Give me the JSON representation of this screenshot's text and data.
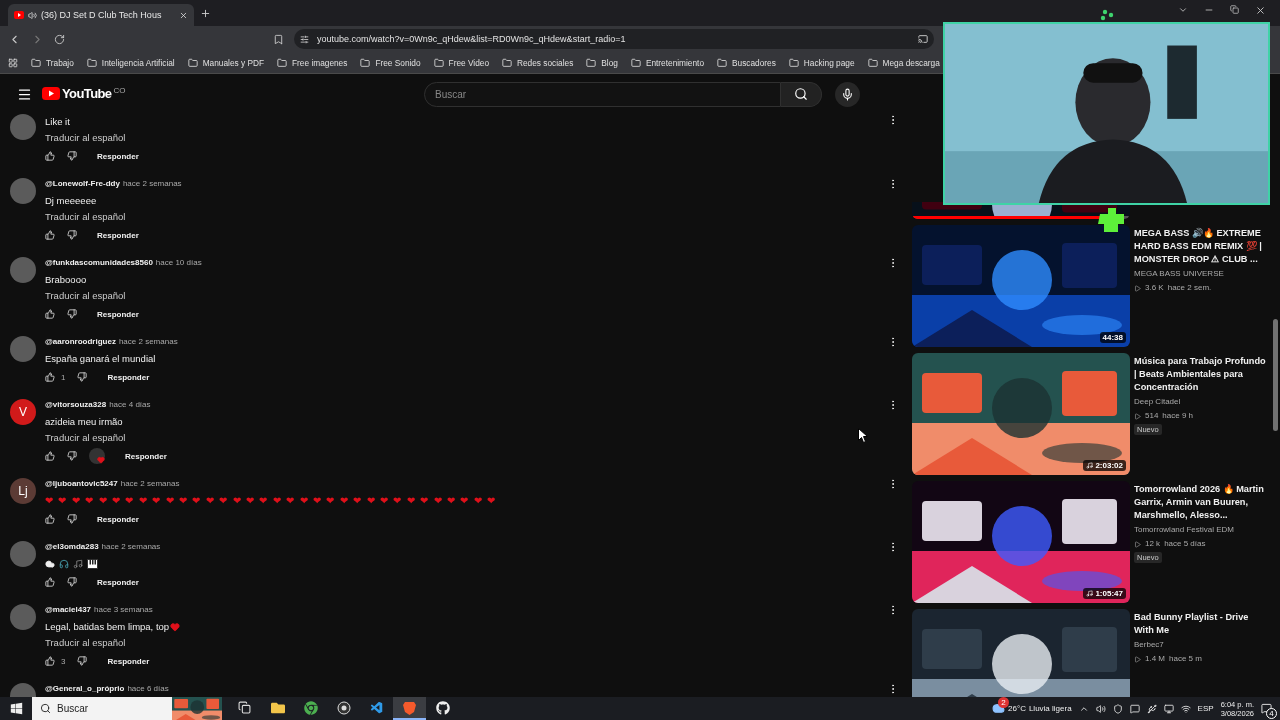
{
  "browser": {
    "tab": {
      "title": "(36) DJ Set D Club Tech Hous",
      "selected": true
    },
    "url": "youtube.com/watch?v=0Wn9c_qHdew&list=RD0Wn9c_qHdew&start_radio=1",
    "bookmarks": [
      "Trabajo",
      "Inteligencia Artificial",
      "Manuales y PDF",
      "Free imagenes",
      "Free Sonido",
      "Free Video",
      "Redes sociales",
      "Blog",
      "Entretenimiento",
      "Buscadores",
      "Hacking page",
      "Mega descarga"
    ]
  },
  "youtube": {
    "logo": "YouTube",
    "country": "CO",
    "search_placeholder": "Buscar"
  },
  "comments": [
    {
      "kind": "text",
      "body": "Like it",
      "translate": "Traducir al español",
      "reply": "Responder",
      "hearted": false
    },
    {
      "kind": "text",
      "author": "@Lonewolf-Fre-ddy",
      "time": "hace 2 semanas",
      "body": "Dj meeeeee",
      "translate": "Traducir al español",
      "reply": "Responder",
      "hearted": false
    },
    {
      "kind": "text",
      "author": "@funkdascomunidades8560",
      "time": "hace 10 días",
      "body": "Braboooo",
      "translate": "Traducir al español",
      "reply": "Responder",
      "hearted": false
    },
    {
      "kind": "text",
      "author": "@aaronroodriguez",
      "time": "hace 2 semanas",
      "body": "España ganará el mundial",
      "likes": "1",
      "reply": "Responder",
      "hearted": false
    },
    {
      "kind": "text",
      "avatar": {
        "kind": "letter",
        "text": "V",
        "color": "#d11a1a"
      },
      "author": "@vitorsouza328",
      "time": "hace 4 días",
      "body": "azideia meu irmão",
      "translate": "Traducir al español",
      "reply": "Responder",
      "hearted": true
    },
    {
      "kind": "hearts",
      "avatar": {
        "kind": "letter",
        "text": "Lj",
        "color": "#5c3b35"
      },
      "author": "@ljuboantovic5247",
      "time": "hace 2 semanas",
      "body": "❤❤❤❤❤❤❤❤❤❤❤❤❤❤❤❤❤❤❤❤❤❤❤❤❤❤❤❤❤❤❤❤❤❤",
      "reply": "Responder",
      "hearted": false
    },
    {
      "kind": "emoji",
      "author": "@el3omda283",
      "time": "hace 2 semanas",
      "reply": "Responder",
      "hearted": false
    },
    {
      "kind": "heart_end",
      "author": "@maciel437",
      "time": "hace 3 semanas",
      "body": "Legal, batidas bem limpa,  top",
      "translate": "Traducir al español",
      "likes": "3",
      "reply": "Responder",
      "hearted": false
    },
    {
      "kind": "partial",
      "author": "@General_o_próprio",
      "time": "hace 6 días",
      "hearted": false
    }
  ],
  "videos": [
    {
      "kind": "partial",
      "level": 0.97
    },
    {
      "kind": "full",
      "title": "MEGA BASS 🔊🔥 EXTREME HARD BASS EDM REMIX 💯 | MONSTER DROP ⚠ CLUB ...",
      "channel": "MEGA BASS UNIVERSE",
      "views": "3.6 K",
      "age": "hace 2 sem.",
      "duration": "44:38",
      "music": false
    },
    {
      "kind": "full",
      "title": "Música para Trabajo Profundo | Beats Ambientales para Concentración",
      "channel": "Deep Citadel",
      "views": "514",
      "age": "hace 9 h",
      "badge": "Nuevo",
      "duration": "2:03:02",
      "music": true
    },
    {
      "kind": "full",
      "title": "Tomorrowland 2026 🔥 Martin Garrix, Armin van Buuren, Marshmello, Alesso...",
      "channel": "Tomorrowland Festival EDM",
      "views": "12 k",
      "age": "hace 5 días",
      "badge": "Nuevo",
      "duration": "1:05:47",
      "music": true
    },
    {
      "kind": "full",
      "title": "Bad Bunny Playlist - Drive With Me",
      "channel": "Berbec7",
      "views": "1.4 M",
      "age": "hace 5 m"
    }
  ],
  "taskbar": {
    "search": "Buscar",
    "apps": [
      {
        "kind": "taskview",
        "selected": false
      },
      {
        "kind": "explorer",
        "selected": false
      },
      {
        "kind": "chrome",
        "selected": false
      },
      {
        "kind": "obs",
        "selected": false
      },
      {
        "kind": "vscode",
        "selected": false
      },
      {
        "kind": "brave",
        "selected": true
      },
      {
        "kind": "github",
        "selected": false
      }
    ],
    "weather_badge": "2",
    "temperature": "26°C",
    "weather": "Lluvia ligera",
    "language": "ESP",
    "time": "6:04 p. m.",
    "date": "3/08/2026",
    "notifications": "4"
  }
}
